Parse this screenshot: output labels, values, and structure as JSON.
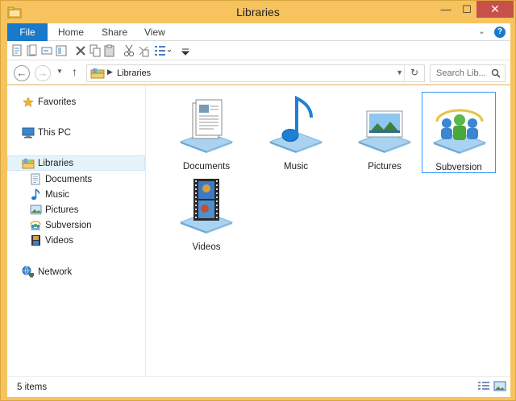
{
  "window": {
    "title": "Libraries"
  },
  "title_controls": {
    "minimize": "—",
    "maximize": "☐",
    "close": "✕"
  },
  "ribbon": {
    "tabs": [
      {
        "label": "File"
      },
      {
        "label": "Home"
      },
      {
        "label": "Share"
      },
      {
        "label": "View"
      }
    ]
  },
  "nav": {
    "back": "←",
    "forward": "→",
    "up": "↑",
    "breadcrumb": [
      "Libraries"
    ],
    "search_placeholder": "Search Lib..."
  },
  "sidebar": {
    "items": [
      {
        "label": "Favorites",
        "icon": "star-icon"
      },
      {
        "label": "This PC",
        "icon": "computer-icon"
      },
      {
        "label": "Libraries",
        "icon": "libraries-icon",
        "selected": true
      },
      {
        "label": "Documents",
        "icon": "documents-icon"
      },
      {
        "label": "Music",
        "icon": "music-icon"
      },
      {
        "label": "Pictures",
        "icon": "pictures-icon"
      },
      {
        "label": "Subversion",
        "icon": "subversion-icon"
      },
      {
        "label": "Videos",
        "icon": "videos-icon"
      },
      {
        "label": "Network",
        "icon": "network-icon"
      }
    ]
  },
  "main": {
    "items": [
      {
        "label": "Documents",
        "icon": "documents-library-icon"
      },
      {
        "label": "Music",
        "icon": "music-library-icon"
      },
      {
        "label": "Pictures",
        "icon": "pictures-library-icon"
      },
      {
        "label": "Subversion",
        "icon": "subversion-library-icon",
        "selected": true
      },
      {
        "label": "Videos",
        "icon": "videos-library-icon"
      }
    ]
  },
  "status": {
    "count_text": "5 items"
  },
  "colors": {
    "frame": "#f6c35e",
    "file_tab": "#1979ca",
    "selection_border": "#3399ff",
    "close_button": "#c7504b"
  }
}
